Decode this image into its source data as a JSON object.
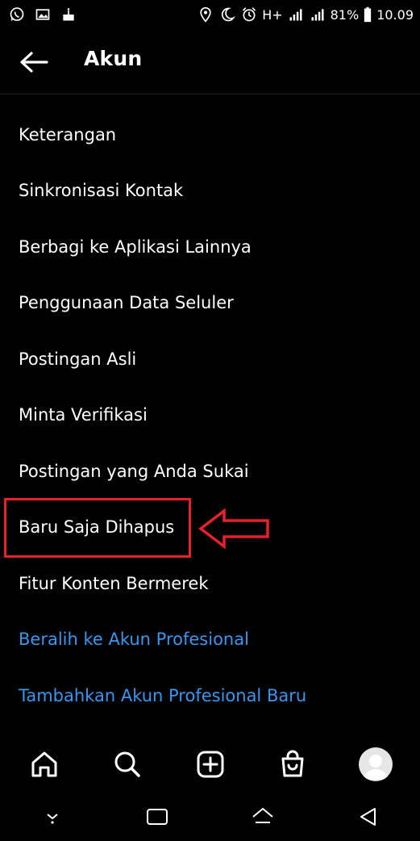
{
  "status_bar": {
    "battery": "81%",
    "time": "10.09",
    "network": "H+",
    "sim1": "1",
    "sim2": "2"
  },
  "header": {
    "title": "Akun"
  },
  "menu": {
    "items": [
      {
        "label": "Keterangan"
      },
      {
        "label": "Sinkronisasi Kontak"
      },
      {
        "label": "Berbagi ke Aplikasi Lainnya"
      },
      {
        "label": "Penggunaan Data Seluler"
      },
      {
        "label": "Postingan Asli"
      },
      {
        "label": "Minta Verifikasi"
      },
      {
        "label": "Postingan yang Anda Sukai"
      },
      {
        "label": "Baru Saja Dihapus"
      },
      {
        "label": "Fitur Konten Bermerek"
      }
    ],
    "links": [
      {
        "label": "Beralih ke Akun Profesional"
      },
      {
        "label": "Tambahkan Akun Profesional Baru"
      }
    ]
  },
  "colors": {
    "link": "#3897f0",
    "annotation": "#e8202a",
    "background": "#000000"
  },
  "icons": {
    "tab_bar": [
      "home-icon",
      "search-icon",
      "new-post-icon",
      "shop-icon",
      "profile-avatar"
    ],
    "system_nav": [
      "collapse-icon",
      "recent-apps-icon",
      "home-nav-icon",
      "back-nav-icon"
    ]
  }
}
